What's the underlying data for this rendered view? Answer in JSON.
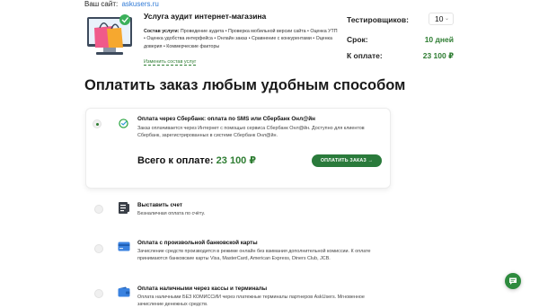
{
  "site": {
    "label": "Ваш сайт:",
    "url": "askusers.ru"
  },
  "service": {
    "title": "Услуга аудит интернет-магазина",
    "details_label": "Состав услуги:",
    "details_text": " Проведение аудита • Проверка мобильной версии сайта • Оценка УТП • Оценка удобства интерфейса • Онлайн заказ • Сравнение с конкурентами • Оценка доверия • Коммерческие факторы",
    "change_link": "Изменить состав услуг"
  },
  "summary": {
    "testers_label": "Тестировщиков:",
    "testers_value": "10",
    "term_label": "Срок:",
    "term_value": "10 дней",
    "pay_label": "К оплате:",
    "pay_value": "23 100 ₽"
  },
  "heading": "Оплатить заказ любым удобным способом",
  "options": [
    {
      "title": "Оплата через Сбербанк: оплата по SMS или Сбербанк Онл@йн",
      "desc": "Заказ оплачивается через Интернет с помощью сервиса Сбербанк Онл@йн. Доступно для клиентов Сбербанк, зарегистрированных в системе Сбербанк Онл@йн.",
      "icon": "sberbank-icon",
      "selected": true
    },
    {
      "title": "Выставить счет",
      "desc": "Безналичная оплата по счёту.",
      "icon": "invoice-icon",
      "selected": false
    },
    {
      "title": "Оплата с произвольной банковской карты",
      "desc": "Зачисление средств производится в режиме онлайн без взимания дополнительной комиссии. К оплате принимаются банковские карты Visa, MasterCard, American Express, Diners Club, JCB.",
      "icon": "bank-card-icon",
      "selected": false
    },
    {
      "title": "Оплата наличными через кассы и терминалы",
      "desc": "Оплата наличными БЕЗ КОМИССИИ через платежные терминалы партнеров AskUsers. Мгновенное зачисление денежных средств.",
      "icon": "wallet-icon",
      "selected": false
    }
  ],
  "total": {
    "label": "Всего к оплате:",
    "value": "23 100 ₽"
  },
  "pay_button": "ОПЛАТИТЬ ЗАКАЗ →",
  "icons": {
    "chat": "chat-icon",
    "testers_dropdown": "chevron-down-icon"
  },
  "colors": {
    "accent_green": "#2e7d32",
    "button_green": "#2a7a3b",
    "link_blue": "#2f7ad6",
    "card_blue": "#3a82e0"
  }
}
